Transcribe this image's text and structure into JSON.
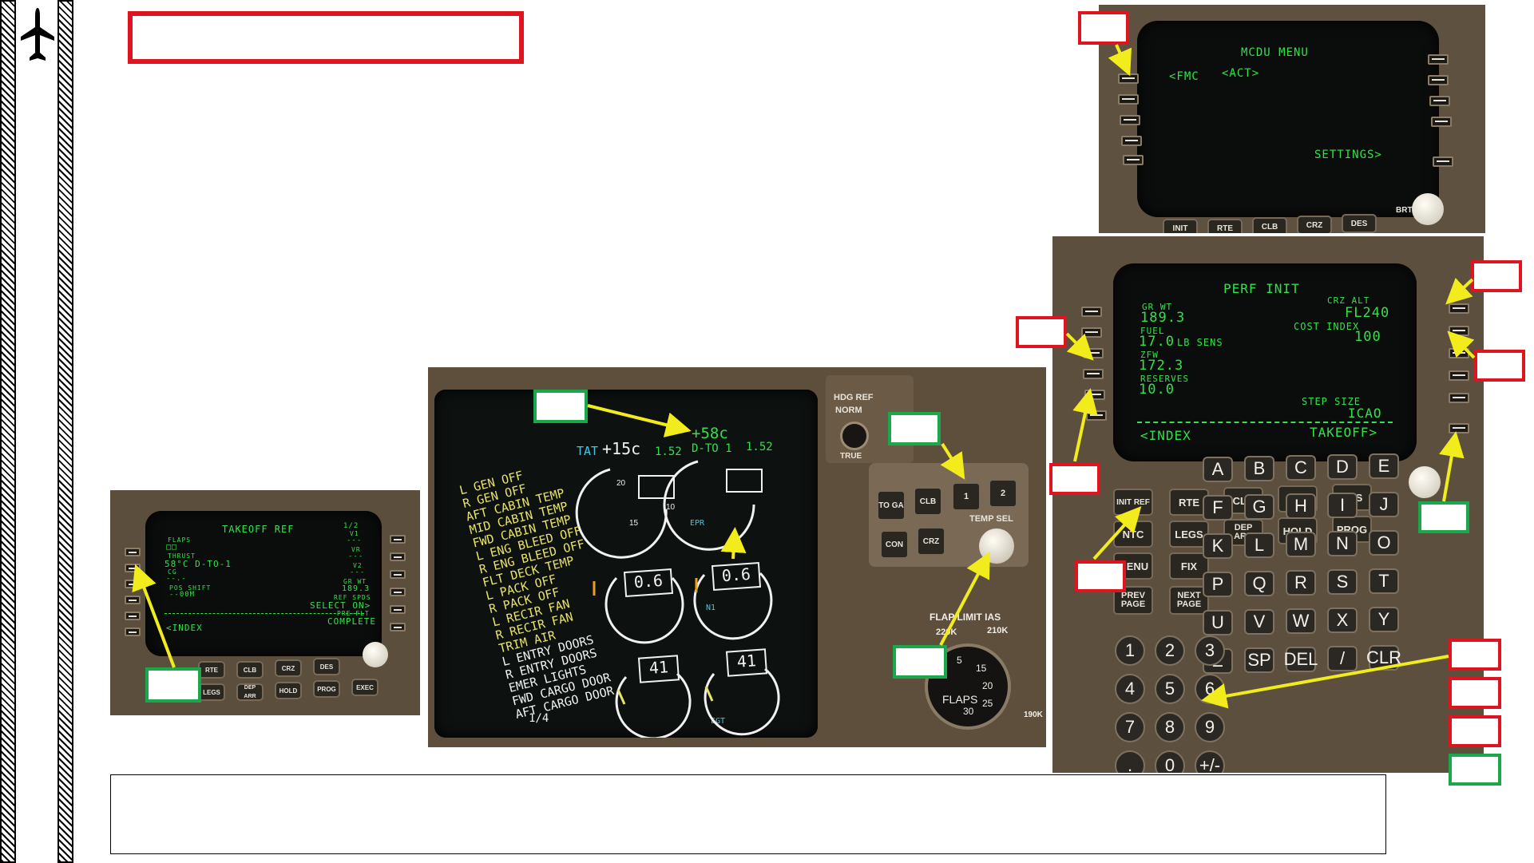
{
  "colors": {
    "callout_red": "#e0141e",
    "callout_green": "#1ba84a",
    "arrow": "#f2ec1c",
    "fmc_green": "#33e04a",
    "eicas_amber": "#e8e36a"
  },
  "sidebar": {
    "icon": "airplane-icon"
  },
  "title_box": {
    "text": ""
  },
  "caption_box": {
    "text": ""
  },
  "mcdu_menu": {
    "title": "MCDU MENU",
    "left1": "<FMC",
    "left1b": "<ACT>",
    "right5": "SETTINGS>",
    "keys": [
      "INIT",
      "RTE",
      "CLB",
      "CRZ",
      "DES"
    ],
    "brt": "BRT"
  },
  "perf_init": {
    "title": "PERF INIT",
    "gr_wt_label": "GR WT",
    "gr_wt": "189.3",
    "crz_alt_label": "CRZ ALT",
    "crz_alt": "FL240",
    "fuel_label": "FUEL",
    "fuel": "17.0",
    "fuel_unit": "LB SENS",
    "cost_index_label": "COST INDEX",
    "cost_index": "100",
    "zfw_label": "ZFW",
    "zfw": "172.3",
    "reserves_label": "RESERVES",
    "reserves": "10.0",
    "step_size_label": "STEP SIZE",
    "step_size": "ICAO",
    "left6": "<INDEX",
    "right6": "TAKEOFF>",
    "fn_row1": [
      "INIT REF",
      "RTE",
      "CLB",
      "CRZ",
      "DES"
    ],
    "fn_row2": [
      "DEP ARR",
      "HOLD",
      "PROG"
    ],
    "fn_misc": [
      "MENU",
      "FIX",
      "PREV PAGE",
      "NEXT PAGE",
      "RTE",
      "NTC",
      "LEGS"
    ],
    "alpha": [
      "A",
      "B",
      "C",
      "D",
      "E",
      "F",
      "G",
      "H",
      "I",
      "J",
      "K",
      "L",
      "M",
      "N",
      "O",
      "P",
      "Q",
      "R",
      "S",
      "T",
      "U",
      "V",
      "W",
      "X",
      "Y",
      "Z",
      "SP",
      "DEL",
      "/",
      "CLR"
    ],
    "digits": [
      "1",
      "2",
      "3",
      "4",
      "5",
      "6",
      "7",
      "8",
      "9",
      ".",
      "0",
      "+/-"
    ]
  },
  "takeoff_ref": {
    "title": "TAKEOFF REF",
    "page": "1/2",
    "flaps_label": "FLAPS",
    "flaps": "□□",
    "thrust_label": "THRUST",
    "thrust": "58°C D-TO-1",
    "cg_label": "CG",
    "cg": "--.-",
    "pos_shift_label": "POS SHIFT",
    "pos_shift": "--00M",
    "v1_label": "V1",
    "vr_label": "VR",
    "v2_label": "V2",
    "v_dash": "---",
    "gr_wt_label": "GR WT",
    "gr_wt": "189.3",
    "ref_spds_label": "REF SPDS",
    "ref_spds": "SELECT ON>",
    "preflt_label": "PRE-FLT",
    "preflt": "COMPLETE",
    "left6": "<INDEX",
    "keys": [
      "RTE",
      "CLB",
      "CRZ",
      "DES",
      "LEGS",
      "DEP ARR",
      "HOLD",
      "PROG",
      "EXEC"
    ]
  },
  "eicas": {
    "tat_label": "TAT",
    "tat": "+15c",
    "assumed": "+58c",
    "mode": "D-TO 1",
    "epr_left": "1.52",
    "epr_right": "1.52",
    "epr_label": "EPR",
    "n1_left": "0.6",
    "n1_right": "0.6",
    "n1_label": "N1",
    "egt_left": "41",
    "egt_right": "41",
    "egt_label": "EGT",
    "dial_20": "20",
    "dial_15": "15",
    "dial_10": "10",
    "messages": [
      "L GEN OFF",
      "R GEN OFF",
      "AFT CABIN TEMP",
      "MID CABIN TEMP",
      "FWD CABIN TEMP",
      "L ENG BLEED OFF",
      "R ENG BLEED OFF",
      "FLT DECK TEMP",
      "L PACK OFF",
      "R PACK OFF",
      "L RECIR FAN",
      "R RECIR FAN",
      "TRIM AIR"
    ],
    "messages_white": [
      "L ENTRY DOORS",
      "R ENTRY DOORS",
      "EMER LIGHTS",
      "FWD CARGO DOOR",
      "AFT CARGO DOOR"
    ],
    "page": "1/4"
  },
  "thrust_panel": {
    "hdg_ref": "HDG REF",
    "norm": "NORM",
    "true": "TRUE",
    "buttons": [
      "TO GA",
      "CLB",
      "1",
      "2",
      "CON",
      "CRZ"
    ],
    "temp_sel": "TEMP SEL",
    "flap_limit": "FLAP LIMIT IAS",
    "s220": "220K",
    "s210": "210K",
    "s190": "190K",
    "flaps_label": "FLAPS",
    "flap_marks": [
      "1",
      "5",
      "15",
      "20",
      "25",
      "30"
    ]
  },
  "footer": {
    "text": ""
  }
}
